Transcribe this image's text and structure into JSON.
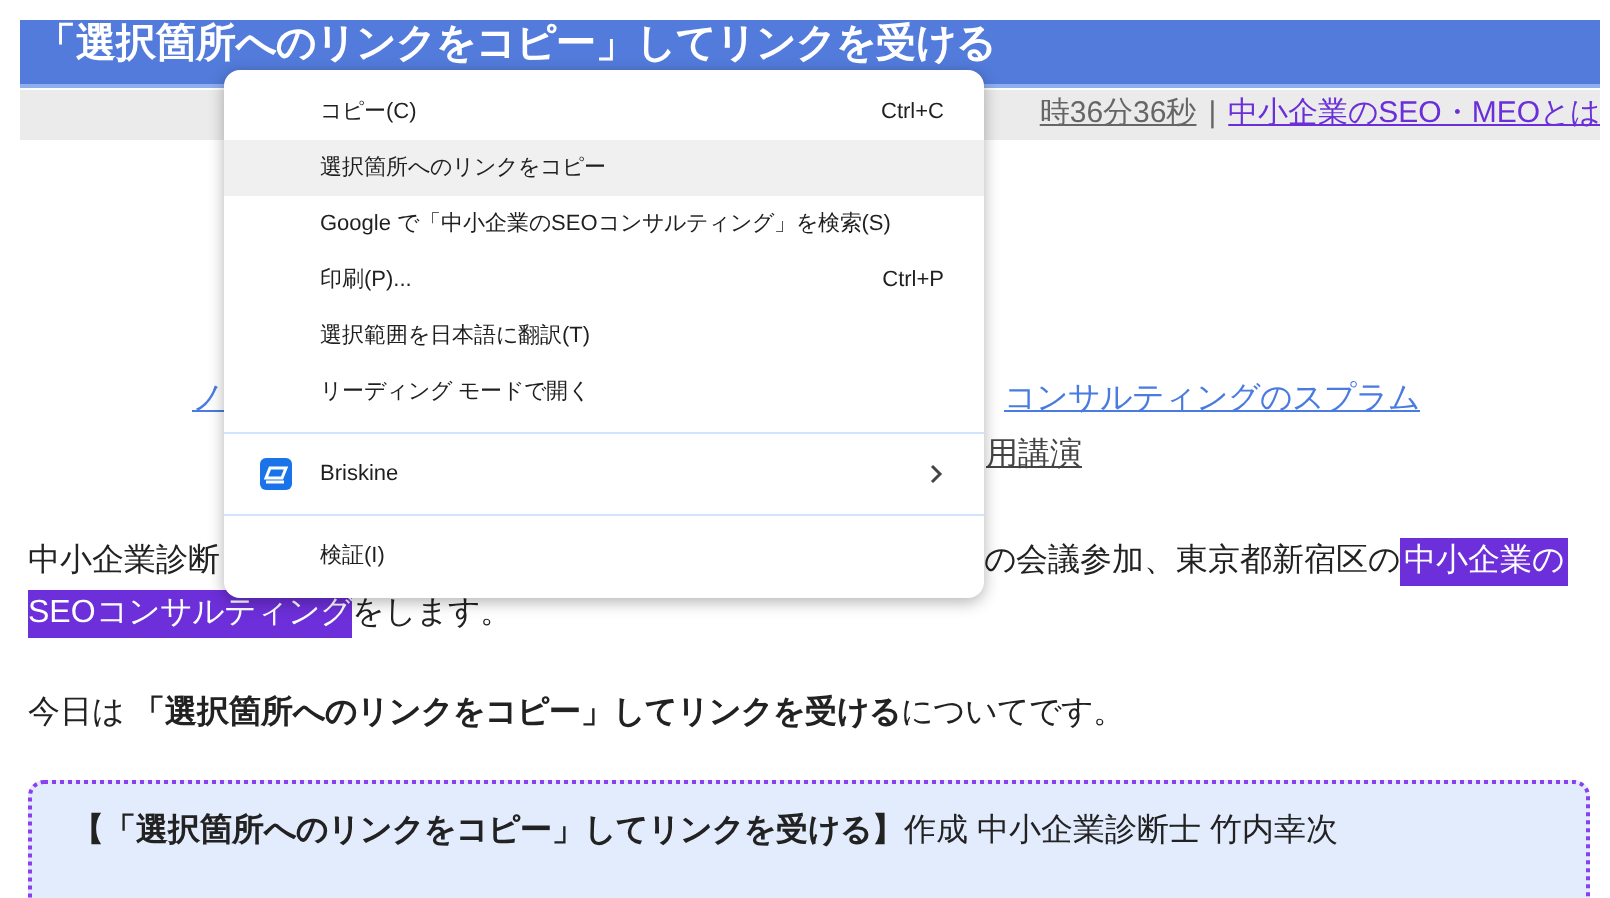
{
  "title": "「選択箇所へのリンクをコピー」してリンクを受ける",
  "meta": {
    "time": "時36分36秒",
    "separator": "|",
    "link": "中小企業のSEO・MEOとは"
  },
  "links": {
    "left_fragment": "ノ",
    "right_link": "コンサルティングのスプラム",
    "right_text": "用講演"
  },
  "paragraph": {
    "line1_left": "中小企業診断",
    "line1_right": "の会議参加、東京都新宿区の",
    "highlight1": "中小企業の",
    "highlight2": "SEOコンサルティング",
    "line2_rest": "をします。"
  },
  "intro": "今日は **「選択箇所へのリンクをコピー」してリンクを受ける**についてです。",
  "box_text": "**【「選択箇所へのリンクをコピー」してリンクを受ける】**作成 中小企業診断士 竹内幸次",
  "context_menu": [
    {
      "kind": "item",
      "label": "コピー(C)",
      "shortcut": "Ctrl+C",
      "selected": false
    },
    {
      "kind": "item",
      "label": "選択箇所へのリンクをコピー",
      "selected": true
    },
    {
      "kind": "item",
      "label": "Google で「中小企業のSEOコンサルティング」を検索(S)",
      "selected": false
    },
    {
      "kind": "item",
      "label": "印刷(P)...",
      "shortcut": "Ctrl+P",
      "selected": false
    },
    {
      "kind": "item",
      "label": "選択範囲を日本語に翻訳(T)",
      "selected": false
    },
    {
      "kind": "item",
      "label": "リーディング モードで開く",
      "selected": false
    },
    {
      "kind": "separator"
    },
    {
      "kind": "submenu",
      "label": "Briskine",
      "selected": false
    },
    {
      "kind": "separator"
    },
    {
      "kind": "item",
      "label": "検証(I)",
      "selected": false
    }
  ]
}
